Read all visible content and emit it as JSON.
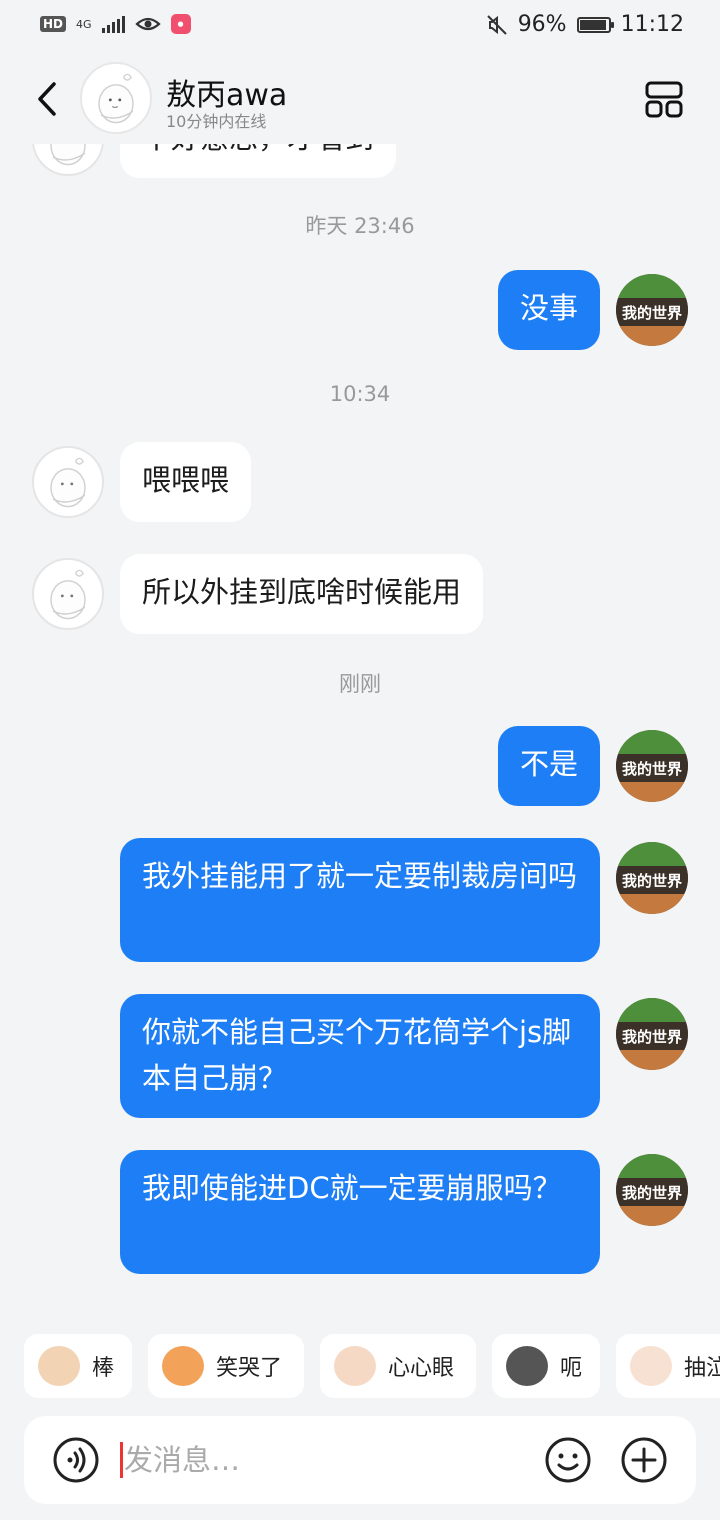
{
  "status_bar": {
    "hd": "HD",
    "network": "4G",
    "battery": "96%",
    "battery_level": 0.96,
    "time": "11:12"
  },
  "header": {
    "name": "敖丙awa",
    "status": "10分钟内在线",
    "back_icon": "chevron-left-icon",
    "menu_icon": "grid-layout-icon"
  },
  "chat": {
    "partial_message": "不好意思，才看到",
    "timestamps": [
      "昨天 23:46",
      "10:34",
      "刚刚"
    ],
    "messages": [
      {
        "from": "me",
        "text": "没事"
      },
      {
        "from": "peer",
        "text": "喂喂喂"
      },
      {
        "from": "peer",
        "text": "所以外挂到底啥时候能用"
      },
      {
        "from": "me",
        "text": "不是"
      },
      {
        "from": "me",
        "text": "我外挂能用了就一定要制裁房间吗"
      },
      {
        "from": "me",
        "text": "你就不能自己买个万花筒学个js脚本自己崩？"
      },
      {
        "from": "me",
        "text": "我即使能进DC就一定要崩服吗？"
      }
    ],
    "my_avatar_text": "我的世界"
  },
  "emoji_suggestions": [
    {
      "label": "棒",
      "color": "#f2d3b4"
    },
    {
      "label": "笑哭了",
      "color": "#f3a25a"
    },
    {
      "label": "心心眼",
      "color": "#f5d9c5"
    },
    {
      "label": "呃",
      "color": "#555555"
    },
    {
      "label": "抽泣",
      "color": "#f6e1d2"
    }
  ],
  "input": {
    "placeholder": "发消息…",
    "voice_icon": "voice-icon",
    "emoji_icon": "smiley-icon",
    "plus_icon": "plus-circle-icon"
  },
  "colors": {
    "accent": "#1e7ef5",
    "background": "#f3f4f6"
  }
}
